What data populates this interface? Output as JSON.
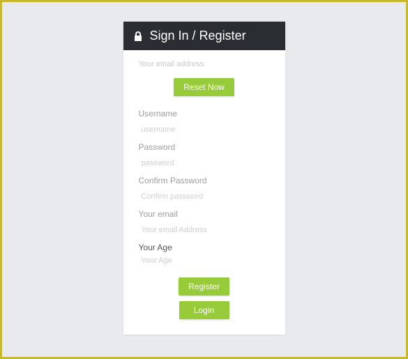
{
  "header": {
    "title": "Sign In / Register"
  },
  "reset": {
    "email_placeholder": "Your email address",
    "button": "Reset Now"
  },
  "form": {
    "username": {
      "label": "Username",
      "placeholder": "username"
    },
    "password": {
      "label": "Password",
      "placeholder": "password"
    },
    "confirm": {
      "label": "Confirm Password",
      "placeholder": "Confirm password"
    },
    "email": {
      "label": "Your email",
      "placeholder": "Your email Address"
    },
    "age": {
      "label": "Your Age",
      "placeholder": "Your Age"
    }
  },
  "actions": {
    "register": "Register",
    "login": "Login"
  }
}
